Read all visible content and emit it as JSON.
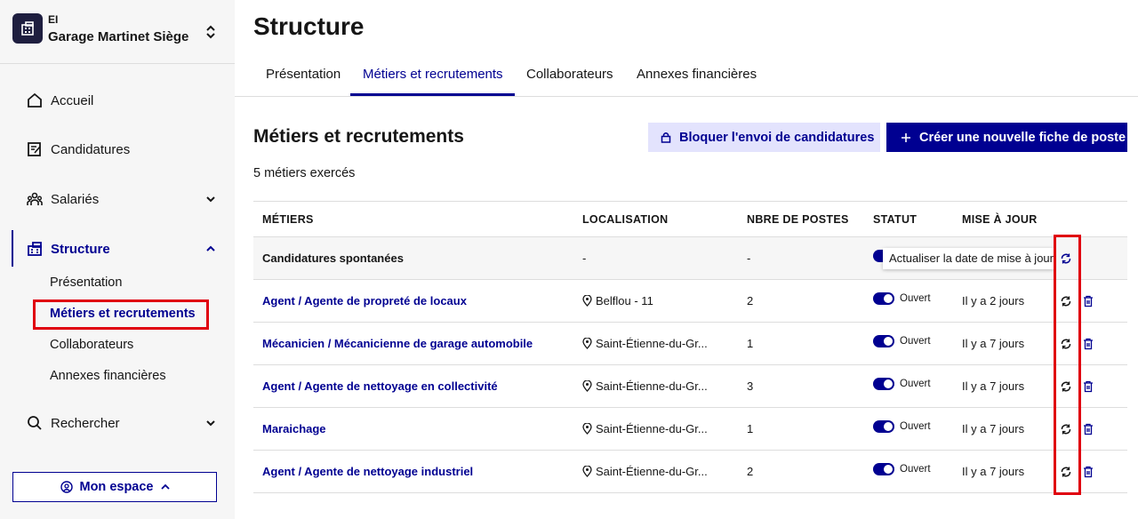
{
  "organization": {
    "kind": "EI",
    "name": "Garage Martinet Siège"
  },
  "sidebar": {
    "nav": [
      {
        "label": "Accueil",
        "icon": "home-icon"
      },
      {
        "label": "Candidatures",
        "icon": "edit-document-icon"
      },
      {
        "label": "Salariés",
        "icon": "team-icon"
      },
      {
        "label": "Structure",
        "icon": "building-icon"
      },
      {
        "label": "Rechercher",
        "icon": "search-icon"
      }
    ],
    "structure_sub": [
      "Présentation",
      "Métiers et recrutements",
      "Collaborateurs",
      "Annexes financières"
    ],
    "mon_espace": "Mon espace"
  },
  "page": {
    "title": "Structure"
  },
  "tabs": [
    "Présentation",
    "Métiers et recrutements",
    "Collaborateurs",
    "Annexes financières"
  ],
  "section": {
    "title": "Métiers et recrutements",
    "count": "5 métiers exercés",
    "block_button": "Bloquer l'envoi de candidatures",
    "create_button": "Créer une nouvelle fiche de poste"
  },
  "table": {
    "headers": [
      "MÉTIERS",
      "LOCALISATION",
      "NBRE DE POSTES",
      "STATUT",
      "MISE À JOUR"
    ],
    "rows": [
      {
        "job": "Candidatures spontanées",
        "location": "-",
        "posts": "-",
        "status": "",
        "updated": ""
      },
      {
        "job": "Agent / Agente de propreté de locaux",
        "location": "Belflou - 11",
        "posts": "2",
        "status": "Ouvert",
        "updated": "Il y a 2 jours"
      },
      {
        "job": "Mécanicien / Mécanicienne de garage automobile",
        "location": "Saint-Étienne-du-Gr...",
        "posts": "1",
        "status": "Ouvert",
        "updated": "Il y a 7 jours"
      },
      {
        "job": "Agent / Agente de nettoyage en collectivité",
        "location": "Saint-Étienne-du-Gr...",
        "posts": "3",
        "status": "Ouvert",
        "updated": "Il y a 7 jours"
      },
      {
        "job": "Maraichage",
        "location": "Saint-Étienne-du-Gr...",
        "posts": "1",
        "status": "Ouvert",
        "updated": "Il y a 7 jours"
      },
      {
        "job": "Agent / Agente de nettoyage industriel",
        "location": "Saint-Étienne-du-Gr...",
        "posts": "2",
        "status": "Ouvert",
        "updated": "Il y a 7 jours"
      }
    ]
  },
  "tooltip": "Actualiser la date de mise à jour",
  "colors": {
    "primary": "#000091",
    "highlight": "#e0000f",
    "secondary_bg": "#e3e3fd",
    "sidebar_bg": "#f6f6f6"
  }
}
